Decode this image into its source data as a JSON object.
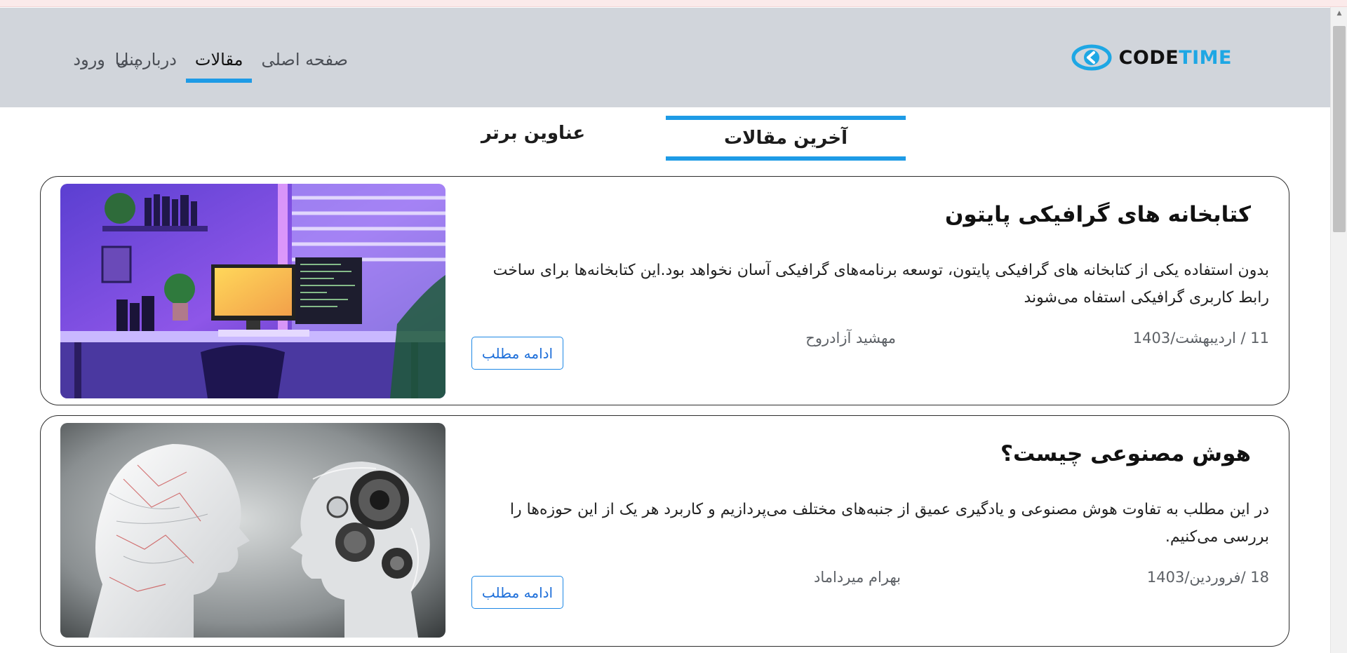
{
  "brand": {
    "code": "CODE",
    "time": "TIME",
    "accent": "#1ea7e4"
  },
  "nav": {
    "items": [
      {
        "label": "صفحه اصلی",
        "active": false
      },
      {
        "label": "مقالات",
        "active": true
      },
      {
        "label": "درباره ما",
        "active": false
      }
    ],
    "user": {
      "panel": "پنل",
      "login": "ورود"
    }
  },
  "tabs": {
    "latest": "آخرین مقالات",
    "top": "عناوین برتر"
  },
  "articles": [
    {
      "title": "کتابخانه های گرافیکی پایتون",
      "excerpt": "بدون استفاده یکی از کتابخانه های گرافیکی پایتون، توسعه برنامه‌های گرافیکی آسان نخواهد بود.این کتابخانه‌ها برای ساخت رابط کاربری گرافیکی استفاه می‌شوند",
      "date": "11 / اردیبهشت/1403",
      "author": "مهشید آزادروح",
      "read_more": "ادامه مطلب"
    },
    {
      "title": "هوش مصنوعی چیست؟",
      "excerpt": "در این مطلب به تفاوت هوش مصنوعی و یادگیری عمیق از جنبه‌های مختلف می‌پردازیم و کاربرد هر یک از این حوزه‌ها را بررسی می‌کنیم.",
      "date": "18 /فروردین/1403",
      "author": "بهرام میرداماد",
      "read_more": "ادامه مطلب"
    }
  ]
}
